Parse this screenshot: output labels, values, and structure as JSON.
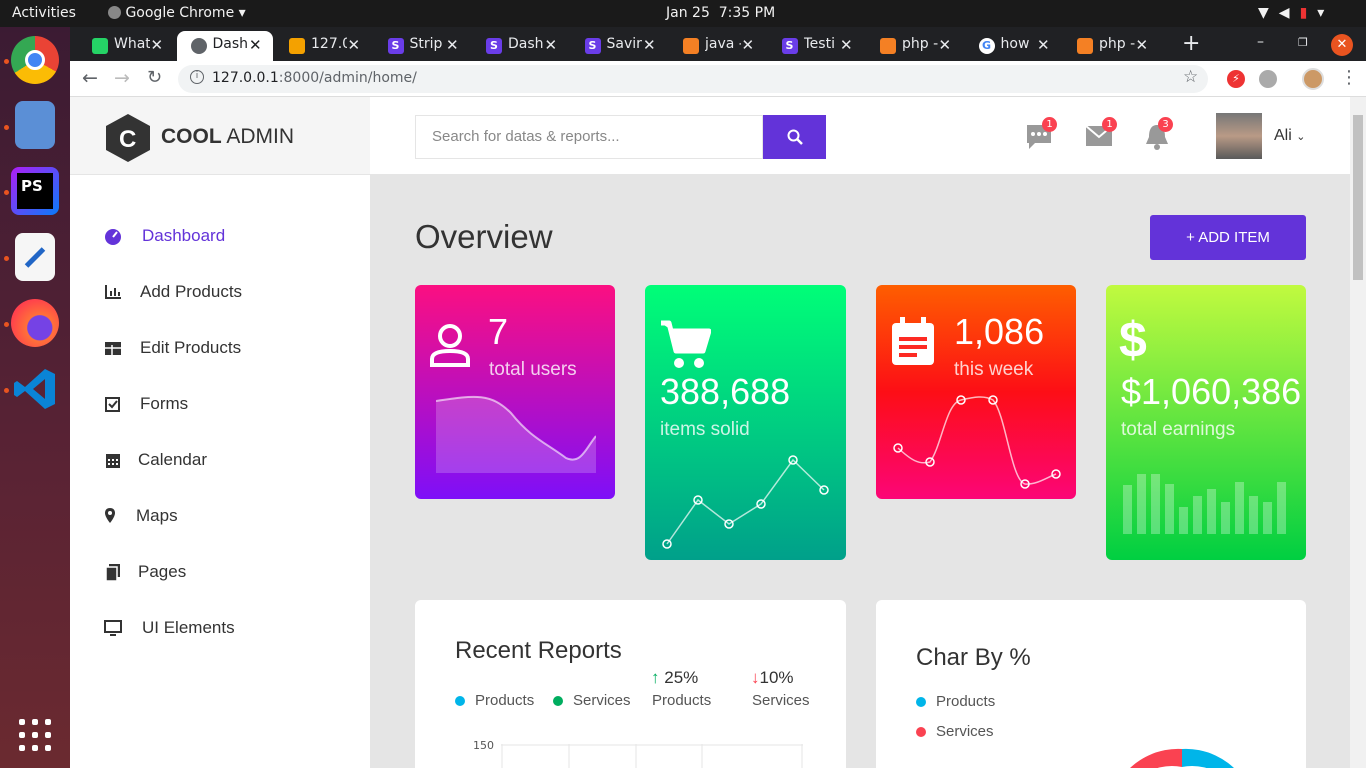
{
  "os_bar": {
    "activities": "Activities",
    "app": "Google Chrome",
    "date": "Jan 25",
    "time": "7:35 PM"
  },
  "dock": [
    "chrome-icon",
    "files-icon",
    "phpstorm-icon",
    "text-editor-icon",
    "firefox-icon",
    "vscode-icon",
    "app-grid-icon"
  ],
  "tabs": [
    {
      "title": "What",
      "icon": "whatsapp-icon",
      "color": "#25d366"
    },
    {
      "title": "Dash",
      "icon": "globe-icon",
      "color": "#5f6368"
    },
    {
      "title": "127.0",
      "icon": "laravel-icon",
      "color": "#f4a100"
    },
    {
      "title": "Strip",
      "icon": "s-icon",
      "color": "#6a3de8"
    },
    {
      "title": "Dash",
      "icon": "s-icon",
      "color": "#6a3de8"
    },
    {
      "title": "Savir",
      "icon": "s-icon",
      "color": "#6a3de8"
    },
    {
      "title": "java -",
      "icon": "stackoverflow-icon",
      "color": "#f48024"
    },
    {
      "title": "Testi",
      "icon": "s-icon",
      "color": "#6a3de8"
    },
    {
      "title": "php -",
      "icon": "stackoverflow-icon",
      "color": "#f48024"
    },
    {
      "title": "how",
      "icon": "google-icon",
      "color": "#4285f4"
    },
    {
      "title": "php -",
      "icon": "stackoverflow-icon",
      "color": "#f48024"
    }
  ],
  "url": {
    "host": "127.0.0.1",
    "rest": ":8000/admin/home/"
  },
  "logo": {
    "bold": "COOL",
    "light": "ADMIN"
  },
  "nav": [
    {
      "label": "Dashboard",
      "icon": "dashboard-icon",
      "active": true
    },
    {
      "label": "Add Products",
      "icon": "bar-chart-icon"
    },
    {
      "label": "Edit Products",
      "icon": "table-icon"
    },
    {
      "label": "Forms",
      "icon": "checkbox-icon"
    },
    {
      "label": "Calendar",
      "icon": "calendar-icon"
    },
    {
      "label": "Maps",
      "icon": "map-marker-icon"
    },
    {
      "label": "Pages",
      "icon": "copy-icon"
    },
    {
      "label": "UI Elements",
      "icon": "desktop-icon"
    }
  ],
  "header": {
    "search_placeholder": "Search for datas & reports...",
    "badges": [
      "1",
      "1",
      "3"
    ],
    "user": "Ali"
  },
  "overview": {
    "title": "Overview",
    "add_button": "+ ADD ITEM"
  },
  "cards": [
    {
      "value": "7",
      "label": "total users",
      "icon": "user-icon"
    },
    {
      "value": "388,688",
      "label": "items solid",
      "icon": "cart-icon"
    },
    {
      "value": "1,086",
      "label": "this week",
      "icon": "calendar-note-icon"
    },
    {
      "value": "$1,060,386",
      "label": "total earnings",
      "icon": "dollar-icon"
    }
  ],
  "reports": {
    "title": "Recent Reports",
    "legend": [
      "Products",
      "Services"
    ],
    "stat1": "25%",
    "stat1_label": "Products",
    "stat2": "10%",
    "stat2_label": "Services",
    "y_tick": "150"
  },
  "charby": {
    "title": "Char By %",
    "legend": [
      "Products",
      "Services"
    ]
  },
  "colors": {
    "accent": "#6333d9",
    "products": "#00b5e9",
    "services": "#00ad5f",
    "charby_services": "#fa4251"
  }
}
